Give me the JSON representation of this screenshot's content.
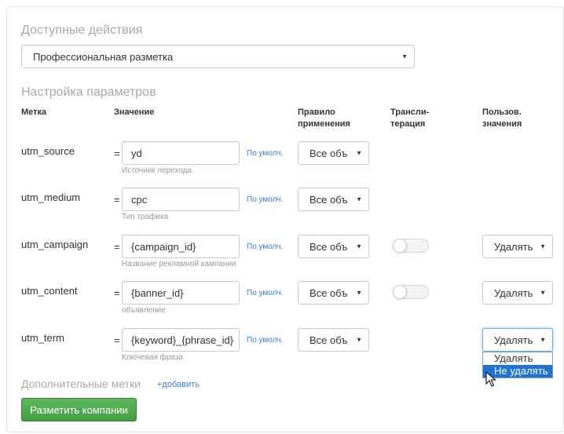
{
  "available_actions": {
    "title": "Доступные действия",
    "selected": "Профессиональная разметка"
  },
  "params": {
    "title": "Настройка параметров",
    "headers": {
      "label": "Метка",
      "value": "Значение",
      "rule_l1": "Правило",
      "rule_l2": "применения",
      "translit_l1": "Трансли-",
      "translit_l2": "терация",
      "user_l1": "Пользов.",
      "user_l2": "значения"
    },
    "rows": [
      {
        "label": "utm_source",
        "eq": "=",
        "value": "yd",
        "hint": "Источник перехода",
        "default_link": "По умолч.",
        "rule": "Все объ"
      },
      {
        "label": "utm_medium",
        "eq": "=",
        "value": "cpc",
        "hint": "Тип трафика",
        "default_link": "По умолч.",
        "rule": "Все объ"
      },
      {
        "label": "utm_campaign",
        "eq": "=",
        "value": "{campaign_id}",
        "hint": "Название рекламной кампании",
        "default_link": "По умолч.",
        "rule": "Все объ",
        "user_value": "Удалять"
      },
      {
        "label": "utm_content",
        "eq": "=",
        "value": "{banner_id}",
        "hint": "объявление",
        "default_link": "По умолч.",
        "rule": "Все объ",
        "user_value": "Удалять"
      },
      {
        "label": "utm_term",
        "eq": "=",
        "value": "{keyword}_{phrase_id}",
        "hint": "Ключевая фраза",
        "default_link": "По умолч.",
        "rule": "Все объ",
        "user_value": "Удалять"
      }
    ],
    "dropdown_options": [
      "Удалять",
      "Не удалять"
    ]
  },
  "extra": {
    "title": "Дополнительные метки",
    "add_link": "+добавить"
  },
  "submit_label": "Разметить компании",
  "colors": {
    "accent_link": "#3a7dc9",
    "button_green": "#5cb85c",
    "selection_blue": "#1e73d4"
  }
}
